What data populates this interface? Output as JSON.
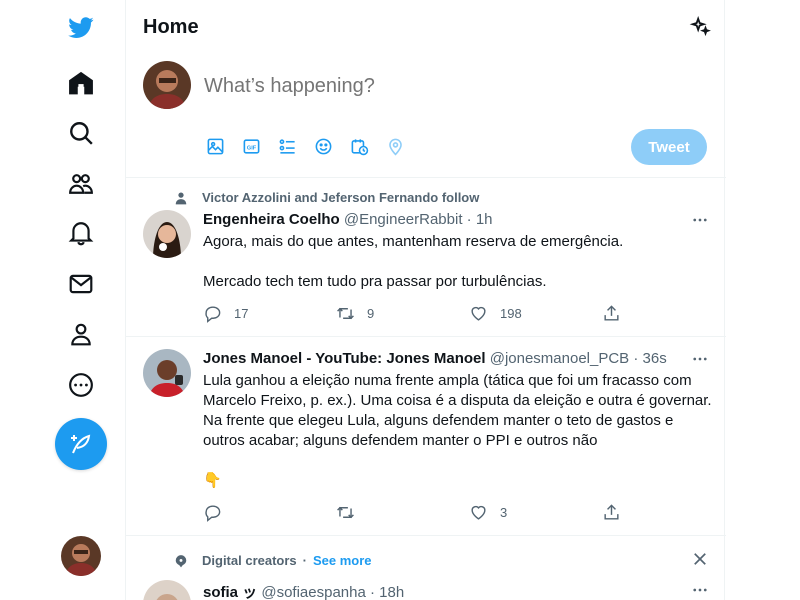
{
  "nav": {
    "items": [
      "twitter-logo-icon",
      "home-icon",
      "explore-icon",
      "communities-icon",
      "notifications-icon",
      "messages-icon",
      "profile-icon",
      "more-icon"
    ]
  },
  "header": {
    "title": "Home"
  },
  "composer": {
    "placeholder": "What’s happening?",
    "tweet_label": "Tweet"
  },
  "posts": [
    {
      "context": "Victor Azzolini and Jeferson Fernando follow",
      "author": "Engenheira Coelho",
      "handle": "@EngineerRabbit",
      "sep": "·",
      "time": "1h",
      "text": "Agora, mais do que antes, mantenham reserva de emergência.\n\nMercado tech tem tudo pra passar por turbulências.",
      "replies": "17",
      "retweets": "9",
      "likes": "198"
    },
    {
      "author": "Jones Manoel - YouTube: Jones Manoel",
      "handle": "@jonesmanoel_PCB",
      "sep": "·",
      "time": "36s",
      "text": "Lula ganhou a eleição numa frente ampla (tática que foi um fracasso com Marcelo Freixo, p. ex.). Uma coisa é a disputa da eleição e outra é governar. Na frente que elegeu Lula, alguns defendem manter o teto de gastos e outros acabar; alguns defendem manter o PPI e outros não\n\n👇",
      "replies": "",
      "retweets": "",
      "likes": "3"
    }
  ],
  "digital": {
    "label": "Digital creators",
    "sep": "·",
    "see_more": "See more",
    "next_author": "sofia ッ",
    "next_handle": "@sofiaespanha",
    "next_time": "18h"
  },
  "colors": {
    "accent": "#1d9bf0",
    "tweet_disabled": "#8ecdf8",
    "muted": "#536471"
  }
}
